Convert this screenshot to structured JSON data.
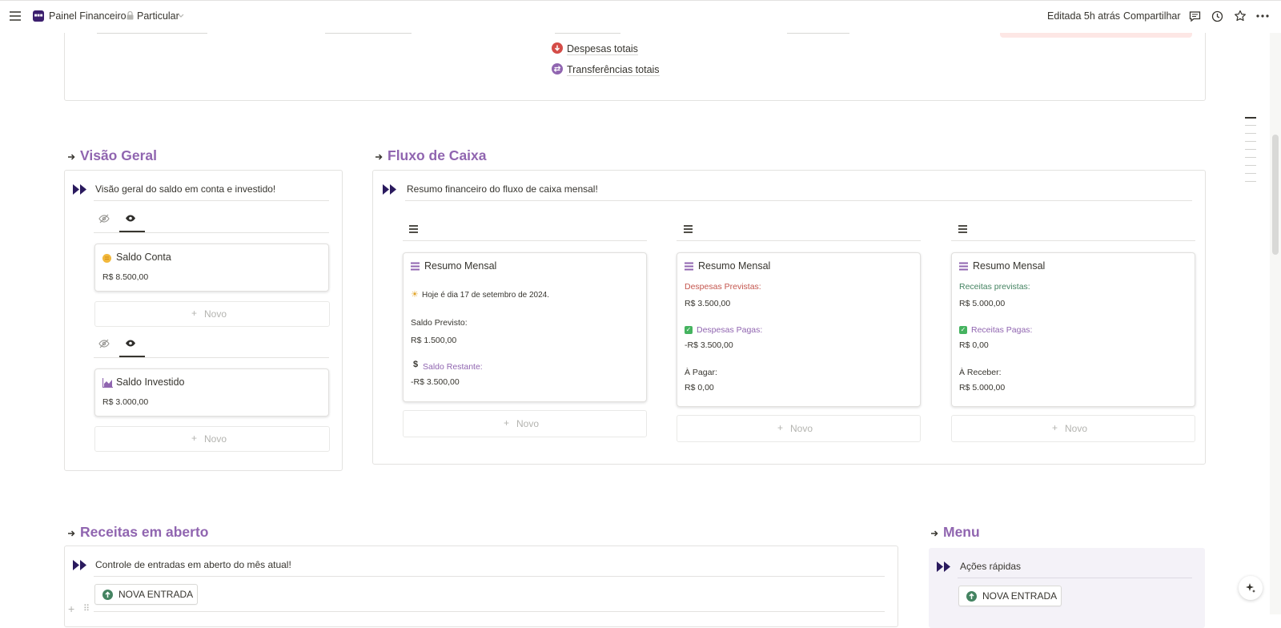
{
  "topbar": {
    "page_title": "Painel Financeiro",
    "privacy": "Particular",
    "edited": "Editada 5h atrás",
    "share": "Compartilhar"
  },
  "top_section": {
    "items": [
      "Despesas totais",
      "Transferências totais"
    ]
  },
  "visao_geral": {
    "title": "Visão Geral",
    "description": "Visão geral do saldo em conta e investido!",
    "groups": [
      {
        "card_title": "Saldo Conta",
        "value": "R$ 8.500,00",
        "new_label": "Novo"
      },
      {
        "card_title": "Saldo Investido",
        "value": "R$ 3.000,00",
        "new_label": "Novo"
      }
    ]
  },
  "fluxo": {
    "title": "Fluxo de Caixa",
    "description": "Resumo financeiro do fluxo de caixa mensal!",
    "columns": [
      {
        "card_title": "Resumo Mensal",
        "today": "Hoje é dia 17 de setembro de 2024.",
        "line2_label": "Saldo Previsto:",
        "line2_value": "R$ 1.500,00",
        "line3_label": "Saldo Restante:",
        "line3_value": "-R$ 3.500,00",
        "new_label": "Novo"
      },
      {
        "card_title": "Resumo Mensal",
        "line1_label": "Despesas Previstas:",
        "line1_value": "R$ 3.500,00",
        "line2_label": "Despesas Pagas:",
        "line2_value": "-R$ 3.500,00",
        "line3_label": "À Pagar:",
        "line3_value": "R$ 0,00",
        "new_label": "Novo"
      },
      {
        "card_title": "Resumo Mensal",
        "line1_label": "Receitas previstas:",
        "line1_value": "R$ 5.000,00",
        "line2_label": "Receitas Pagas:",
        "line2_value": "R$ 0,00",
        "line3_label": "À Receber:",
        "line3_value": "R$ 5.000,00",
        "new_label": "Novo"
      }
    ]
  },
  "receitas": {
    "title": "Receitas em aberto",
    "description": "Controle de entradas em aberto do mês atual!",
    "button": "NOVA ENTRADA"
  },
  "menu": {
    "title": "Menu",
    "subtitle": "Ações rápidas",
    "button": "NOVA ENTRADA"
  },
  "colors": {
    "accent": "#9065b0",
    "dark_purple": "#2a1a5e",
    "red": "#c4554d",
    "green": "#448361",
    "check_green": "#45b35f"
  }
}
